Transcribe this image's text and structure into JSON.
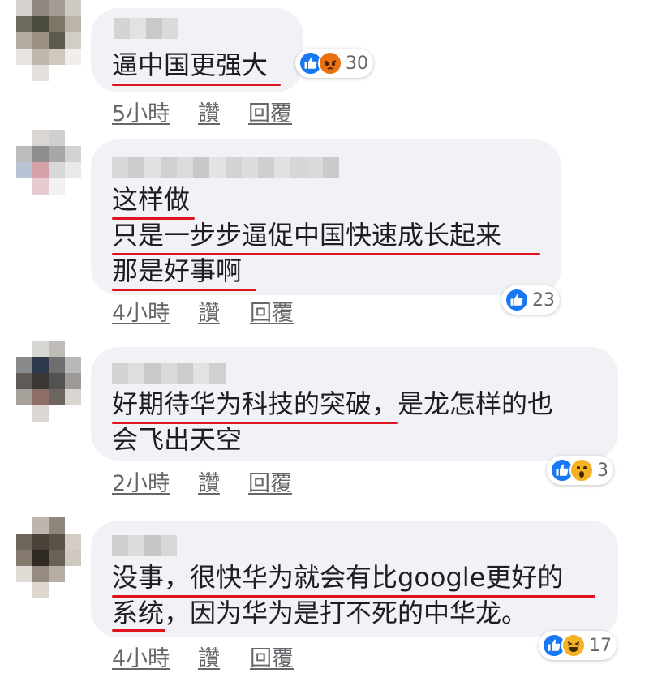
{
  "comments": [
    {
      "lines": [
        "逼中国更强大"
      ],
      "reactions": {
        "icons": [
          "like-icon",
          "angry-icon"
        ],
        "count": "30"
      },
      "time": "5小時",
      "like": "讚",
      "reply": "回覆"
    },
    {
      "lines": [
        "这样做",
        "只是一步步逼促中国快速成长起来",
        "那是好事啊"
      ],
      "reactions": {
        "icons": [
          "like-icon"
        ],
        "count": "23"
      },
      "time": "4小時",
      "like": "讚",
      "reply": "回覆"
    },
    {
      "lines": [
        "好期待华为科技的突破，是龙怎样的也",
        "会飞出天空"
      ],
      "reactions": {
        "icons": [
          "like-icon",
          "wow-icon"
        ],
        "count": "3"
      },
      "time": "2小時",
      "like": "讚",
      "reply": "回覆"
    },
    {
      "lines": [
        "没事，很快华为就会有比google更好的",
        "系统，因为华为是打不死的中华龙。"
      ],
      "reactions": {
        "icons": [
          "like-icon",
          "haha-icon"
        ],
        "count": "17"
      },
      "time": "4小時",
      "like": "讚",
      "reply": "回覆"
    }
  ],
  "colors": {
    "bubble": "#f0f2f5",
    "underline": "#e0141e",
    "like_blue": "#1877f2",
    "angry_orange": "#e9710f",
    "emoji_yellow": "#f7b125"
  }
}
